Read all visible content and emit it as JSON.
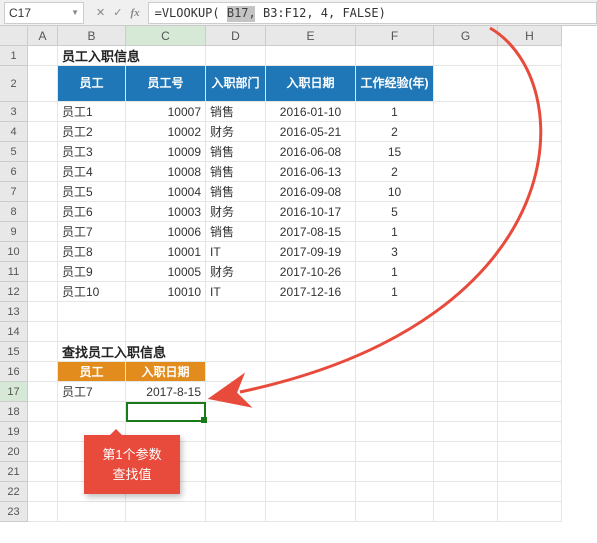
{
  "nameBox": "C17",
  "formula": "=VLOOKUP( B17, B3:F12, 4, FALSE)",
  "cols": [
    "A",
    "B",
    "C",
    "D",
    "E",
    "F",
    "G",
    "H"
  ],
  "rows": [
    "1",
    "2",
    "3",
    "4",
    "5",
    "6",
    "7",
    "8",
    "9",
    "10",
    "11",
    "12",
    "13",
    "14",
    "15",
    "16",
    "17",
    "18",
    "19",
    "20",
    "21",
    "22",
    "23"
  ],
  "title1": "员工入职信息",
  "headers1": {
    "emp": "员工",
    "id": "员工号",
    "dept": "入职部门",
    "date": "入职日期",
    "exp": "工作经验(年)"
  },
  "data1": [
    {
      "emp": "员工1",
      "id": "10007",
      "dept": "销售",
      "date": "2016-01-10",
      "exp": "1"
    },
    {
      "emp": "员工2",
      "id": "10002",
      "dept": "财务",
      "date": "2016-05-21",
      "exp": "2"
    },
    {
      "emp": "员工3",
      "id": "10009",
      "dept": "销售",
      "date": "2016-06-08",
      "exp": "15"
    },
    {
      "emp": "员工4",
      "id": "10008",
      "dept": "销售",
      "date": "2016-06-13",
      "exp": "2"
    },
    {
      "emp": "员工5",
      "id": "10004",
      "dept": "销售",
      "date": "2016-09-08",
      "exp": "10"
    },
    {
      "emp": "员工6",
      "id": "10003",
      "dept": "财务",
      "date": "2016-10-17",
      "exp": "5"
    },
    {
      "emp": "员工7",
      "id": "10006",
      "dept": "销售",
      "date": "2017-08-15",
      "exp": "1"
    },
    {
      "emp": "员工8",
      "id": "10001",
      "dept": "IT",
      "date": "2017-09-19",
      "exp": "3"
    },
    {
      "emp": "员工9",
      "id": "10005",
      "dept": "财务",
      "date": "2017-10-26",
      "exp": "1"
    },
    {
      "emp": "员工10",
      "id": "10010",
      "dept": "IT",
      "date": "2017-12-16",
      "exp": "1"
    }
  ],
  "title2": "查找员工入职信息",
  "headers2": {
    "emp": "员工",
    "date": "入职日期"
  },
  "lookup": {
    "emp": "员工7",
    "date": "2017-8-15"
  },
  "callout": {
    "l1": "第1个参数",
    "l2": "查找值"
  }
}
